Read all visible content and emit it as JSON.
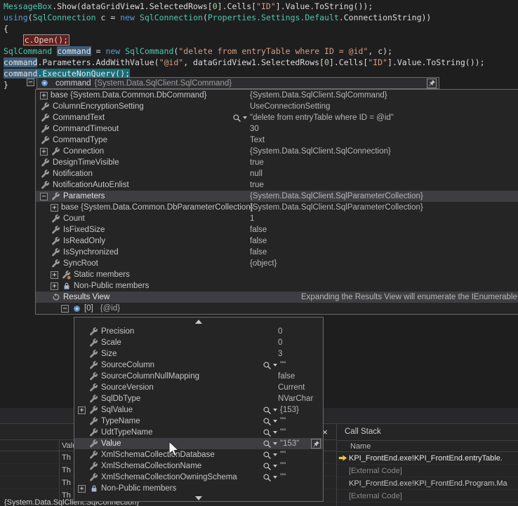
{
  "colors": {
    "keyword": "#569CD6",
    "type": "#4EC9B0",
    "string": "#D69D85",
    "number": "#B5CEA8",
    "selection": "#176E78",
    "symbol_highlight": "#3E5C76",
    "breakpoint": "#63201C",
    "row_highlight": "#3E3E42",
    "arrow": "#E8C93F"
  },
  "editor": {
    "lines": [
      {
        "segments": [
          {
            "t": "MessageBox",
            "c": "type"
          },
          {
            "t": ".Show(dataGridView1.SelectedRows[",
            "c": "plain"
          },
          {
            "t": "0",
            "c": "num"
          },
          {
            "t": "].Cells[",
            "c": "plain"
          },
          {
            "t": "\"ID\"",
            "c": "str"
          },
          {
            "t": "].Value.ToString());",
            "c": "plain"
          }
        ]
      },
      {
        "segments": [
          {
            "t": "using",
            "c": "kw"
          },
          {
            "t": "(",
            "c": "plain"
          },
          {
            "t": "SqlConnection",
            "c": "type"
          },
          {
            "t": " c = ",
            "c": "plain"
          },
          {
            "t": "new",
            "c": "kw"
          },
          {
            "t": " ",
            "c": "plain"
          },
          {
            "t": "SqlConnection",
            "c": "type"
          },
          {
            "t": "(",
            "c": "plain"
          },
          {
            "t": "Properties.Settings.Default",
            "c": "type"
          },
          {
            "t": ".ConnectionString))",
            "c": "plain"
          }
        ]
      },
      {
        "segments": [
          {
            "t": "{",
            "c": "plain"
          }
        ]
      },
      {
        "segments": [
          {
            "t": "    ",
            "c": "plain"
          },
          {
            "t": "c.Open();",
            "c": "brk"
          }
        ]
      },
      {
        "segments": [
          {
            "t": "SqlCommand",
            "c": "type"
          },
          {
            "t": " ",
            "c": "plain"
          },
          {
            "t": "command",
            "c": "hlword"
          },
          {
            "t": " = ",
            "c": "plain"
          },
          {
            "t": "new",
            "c": "kw"
          },
          {
            "t": " ",
            "c": "plain"
          },
          {
            "t": "SqlCommand",
            "c": "type"
          },
          {
            "t": "(",
            "c": "plain"
          },
          {
            "t": "\"delete from entryTable where ID = @id\"",
            "c": "str"
          },
          {
            "t": ", c);",
            "c": "plain"
          }
        ]
      },
      {
        "segments": [
          {
            "t": "command",
            "c": "hlword"
          },
          {
            "t": ".Parameters.AddWithValue(",
            "c": "plain"
          },
          {
            "t": "\"@id\"",
            "c": "str"
          },
          {
            "t": ", dataGridView1.SelectedRows[",
            "c": "plain"
          },
          {
            "t": "0",
            "c": "num"
          },
          {
            "t": "].Cells[",
            "c": "plain"
          },
          {
            "t": "\"ID\"",
            "c": "str"
          },
          {
            "t": "].Value.ToString());",
            "c": "plain"
          }
        ]
      },
      {
        "segments": [
          {
            "t": "command",
            "c": "hlword"
          },
          {
            "t": ".ExecuteNonQuery();",
            "c": "sel"
          }
        ]
      },
      {
        "segments": [
          {
            "t": "}",
            "c": "plain"
          }
        ]
      }
    ]
  },
  "datatip": {
    "root": {
      "expander": "-",
      "name": "command",
      "type": "{System.Data.SqlClient.SqlCommand}"
    },
    "rows": [
      {
        "exp": "+",
        "name": "base {System.Data.Common.DbCommand}",
        "value": "{System.Data.SqlClient.SqlCommand}"
      },
      {
        "icon": "wrench",
        "name": "ColumnEncryptionSetting",
        "value": "UseConnectionSetting"
      },
      {
        "icon": "wrench",
        "name": "CommandText",
        "mag": true,
        "value": "\"delete from entryTable where ID = @id\""
      },
      {
        "icon": "wrench",
        "name": "CommandTimeout",
        "value": "30"
      },
      {
        "icon": "wrench",
        "name": "CommandType",
        "value": "Text"
      },
      {
        "exp": "+",
        "icon": "wrench",
        "name": "Connection",
        "value": "{System.Data.SqlClient.SqlConnection}"
      },
      {
        "icon": "wrench",
        "name": "DesignTimeVisible",
        "value": "true"
      },
      {
        "icon": "wrench",
        "name": "Notification",
        "value": "null"
      },
      {
        "icon": "wrench",
        "name": "NotificationAutoEnlist",
        "value": "true"
      },
      {
        "exp": "-",
        "icon": "wrench",
        "name": "Parameters",
        "value": "{System.Data.SqlClient.SqlParameterCollection}",
        "hl": true
      },
      {
        "indent": 1,
        "exp": "+",
        "name": "base {System.Data.Common.DbParameterCollection}",
        "value": "{System.Data.SqlClient.SqlParameterCollection}"
      },
      {
        "indent": 1,
        "icon": "wrench",
        "name": "Count",
        "value": "1"
      },
      {
        "indent": 1,
        "icon": "wrench",
        "name": "IsFixedSize",
        "value": "false"
      },
      {
        "indent": 1,
        "icon": "wrench",
        "name": "IsReadOnly",
        "value": "false"
      },
      {
        "indent": 1,
        "icon": "wrench",
        "name": "IsSynchronized",
        "value": "false"
      },
      {
        "indent": 1,
        "icon": "wrench",
        "name": "SyncRoot",
        "value": "{object}"
      },
      {
        "indent": 1,
        "exp": "+",
        "icon": "static",
        "name": "Static members"
      },
      {
        "indent": 1,
        "exp": "+",
        "icon": "nonpublic",
        "name": "Non-Public members"
      },
      {
        "indent": 1,
        "icon": "results",
        "name": "Results View",
        "value": "Expanding the Results View will enumerate the IEnumerable",
        "hl": true,
        "valLeft": 378
      },
      {
        "indent": 2,
        "exp": "-",
        "icon": "param",
        "name": "[0]",
        "value": "{@id}",
        "inlineVal": true
      }
    ]
  },
  "param_tip": {
    "rows": [
      {
        "indent": 1,
        "icon": "wrench",
        "name": "Precision",
        "value": "0"
      },
      {
        "indent": 1,
        "icon": "wrench",
        "name": "Scale",
        "value": "0"
      },
      {
        "indent": 1,
        "icon": "wrench",
        "name": "Size",
        "value": "3"
      },
      {
        "indent": 1,
        "icon": "wrench",
        "name": "SourceColumn",
        "mag": true,
        "value": "\"\""
      },
      {
        "indent": 1,
        "icon": "wrench",
        "name": "SourceColumnNullMapping",
        "value": "false"
      },
      {
        "indent": 1,
        "icon": "wrench",
        "name": "SourceVersion",
        "value": "Current"
      },
      {
        "indent": 1,
        "icon": "wrench",
        "name": "SqlDbType",
        "value": "NVarChar"
      },
      {
        "exp": "+",
        "icon": "wrench",
        "name": "SqlValue",
        "mag": true,
        "value": "{153}"
      },
      {
        "indent": 1,
        "icon": "wrench",
        "name": "TypeName",
        "mag": true,
        "value": "\"\""
      },
      {
        "indent": 1,
        "icon": "wrench",
        "name": "UdtTypeName",
        "mag": true,
        "value": "\"\""
      },
      {
        "indent": 1,
        "icon": "wrench",
        "name": "Value",
        "mag": true,
        "value": "\"153\"",
        "hl": true,
        "pin": true
      },
      {
        "indent": 1,
        "icon": "wrench",
        "name": "XmlSchemaCollectionDatabase",
        "mag": true,
        "value": "\"\""
      },
      {
        "indent": 1,
        "icon": "wrench",
        "name": "XmlSchemaCollectionName",
        "mag": true,
        "value": "\"\""
      },
      {
        "indent": 1,
        "icon": "wrench",
        "name": "XmlSchemaCollectionOwningSchema",
        "mag": true,
        "value": "\"\""
      },
      {
        "exp": "+",
        "icon": "nonpublic",
        "name": "Non-Public members"
      }
    ]
  },
  "locals_panel": {
    "header_value": "Value",
    "rows": [
      "Th",
      "Th",
      "Th",
      "Th"
    ],
    "bottom_fragment": "{System.Data.SqlClient.SqlConnection}"
  },
  "callstack": {
    "title": "Call Stack",
    "column": "Name",
    "frames": [
      {
        "text": "KPI_FrontEnd.exe!KPI_FrontEnd.entryTable.",
        "current": true,
        "external": false
      },
      {
        "text": "[External Code]",
        "current": false,
        "external": true
      },
      {
        "text": "KPI_FrontEnd.exe!KPI_FrontEnd.Program.Ma",
        "current": false,
        "external": false
      },
      {
        "text": "[External Code]",
        "current": false,
        "external": true
      }
    ]
  }
}
